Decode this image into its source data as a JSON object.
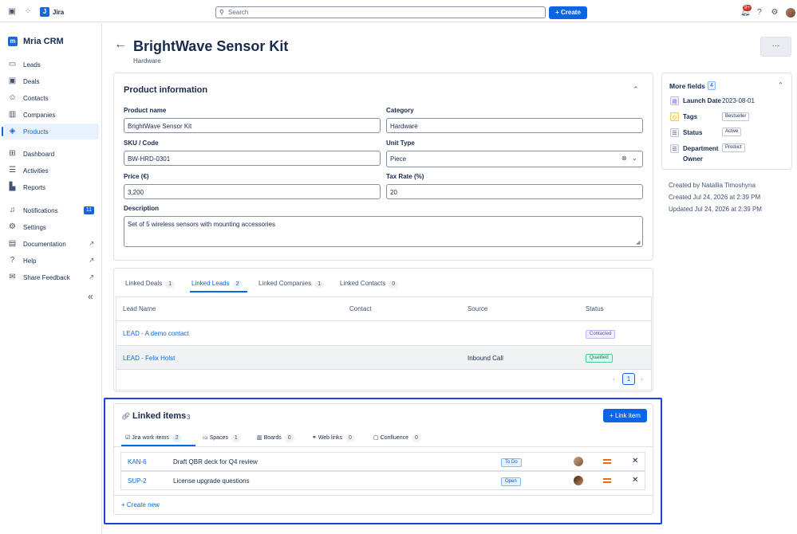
{
  "topbar": {
    "app_name": "Jira",
    "search_placeholder": "Search",
    "create_label": "Create",
    "notification_count": "9+"
  },
  "sidebar": {
    "app_name": "Mria CRM",
    "items": [
      {
        "label": "Leads"
      },
      {
        "label": "Deals"
      },
      {
        "label": "Contacts"
      },
      {
        "label": "Companies"
      },
      {
        "label": "Products"
      },
      {
        "label": "Dashboard"
      },
      {
        "label": "Activities"
      },
      {
        "label": "Reports"
      },
      {
        "label": "Notifications",
        "badge": "11"
      },
      {
        "label": "Settings"
      },
      {
        "label": "Documentation"
      },
      {
        "label": "Help"
      },
      {
        "label": "Share Feedback"
      }
    ]
  },
  "header": {
    "title": "BrightWave Sensor Kit",
    "subtitle": "Hardware",
    "more_label": "···"
  },
  "product_info": {
    "title": "Product information",
    "product_name_label": "Product name",
    "product_name": "BrightWave Sensor Kit",
    "category_label": "Category",
    "category": "Hardware",
    "sku_label": "SKU / Code",
    "sku": "BW-HRD-0301",
    "unit_type_label": "Unit Type",
    "unit_type": "Piece",
    "price_label": "Price (€)",
    "price": "3,200",
    "tax_rate_label": "Tax Rate (%)",
    "tax_rate": "20",
    "description_label": "Description",
    "description": "Set of 5 wireless sensors with mounting accessories"
  },
  "linked_tabs": [
    {
      "label": "Linked Deals",
      "count": "1"
    },
    {
      "label": "Linked Leads",
      "count": "2"
    },
    {
      "label": "Linked Companies",
      "count": "1"
    },
    {
      "label": "Linked Contacts",
      "count": "0"
    }
  ],
  "leads_table": {
    "columns": [
      "Lead Name",
      "Contact",
      "Source",
      "Status"
    ],
    "rows": [
      {
        "name": "LEAD - A demo contact",
        "contact": "",
        "source": "",
        "status": "Contacted"
      },
      {
        "name": "LEAD - Felix Holst",
        "contact": "",
        "source": "Inbound Call",
        "status": "Qualified"
      }
    ],
    "page": "1"
  },
  "more_fields": {
    "title": "More fields",
    "count": "4",
    "launch_date_label": "Launch Date",
    "launch_date": "2023-08-01",
    "tags_label": "Tags",
    "tags": "Bestseller",
    "status_label": "Status",
    "status": "Active",
    "department_label": "Department",
    "department_label2": "Owner",
    "department": "Product"
  },
  "meta": {
    "created_by": "Created by Natallia Timoshyna",
    "created_at": "Created Jul 24, 2026 at 2:39 PM",
    "updated_at": "Updated Jul 24, 2026 at 2:39 PM"
  },
  "linked_items": {
    "title": "Linked items",
    "count": "3",
    "link_button": "Link item",
    "tabs": [
      {
        "label": "Jira work items",
        "count": "2"
      },
      {
        "label": "Spaces",
        "count": "1"
      },
      {
        "label": "Boards",
        "count": "0"
      },
      {
        "label": "Web links",
        "count": "0"
      },
      {
        "label": "Confluence",
        "count": "0"
      }
    ],
    "rows": [
      {
        "key": "KAN-6",
        "summary": "Draft QBR deck for Q4 review",
        "status": "To Do"
      },
      {
        "key": "SUP-2",
        "summary": "License upgrade questions",
        "status": "Open"
      }
    ],
    "create_new": "Create new"
  }
}
